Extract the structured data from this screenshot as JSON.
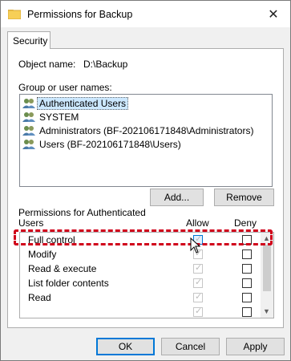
{
  "window": {
    "title": "Permissions for Backup",
    "close_label": "✕"
  },
  "tabs": [
    {
      "label": "Security"
    }
  ],
  "object": {
    "label": "Object name:",
    "value": "D:\\Backup"
  },
  "groups": {
    "label": "Group or user names:",
    "items": [
      {
        "label": "Authenticated Users"
      },
      {
        "label": "SYSTEM"
      },
      {
        "label": "Administrators (BF-202106171848\\Administrators)"
      },
      {
        "label": "Users (BF-202106171848\\Users)"
      }
    ],
    "add_label": "Add...",
    "remove_label": "Remove"
  },
  "permissions": {
    "header_line1": "Permissions for Authenticated",
    "header_line2": "Users",
    "allow_label": "Allow",
    "deny_label": "Deny",
    "rows": [
      {
        "name": "Full control"
      },
      {
        "name": "Modify"
      },
      {
        "name": "Read & execute"
      },
      {
        "name": "List folder contents"
      },
      {
        "name": "Read"
      }
    ]
  },
  "footer": {
    "ok_label": "OK",
    "cancel_label": "Cancel",
    "apply_label": "Apply"
  },
  "colors": {
    "highlight": "#d0021b",
    "selection": "#cce8ff",
    "accent": "#0078d7"
  }
}
